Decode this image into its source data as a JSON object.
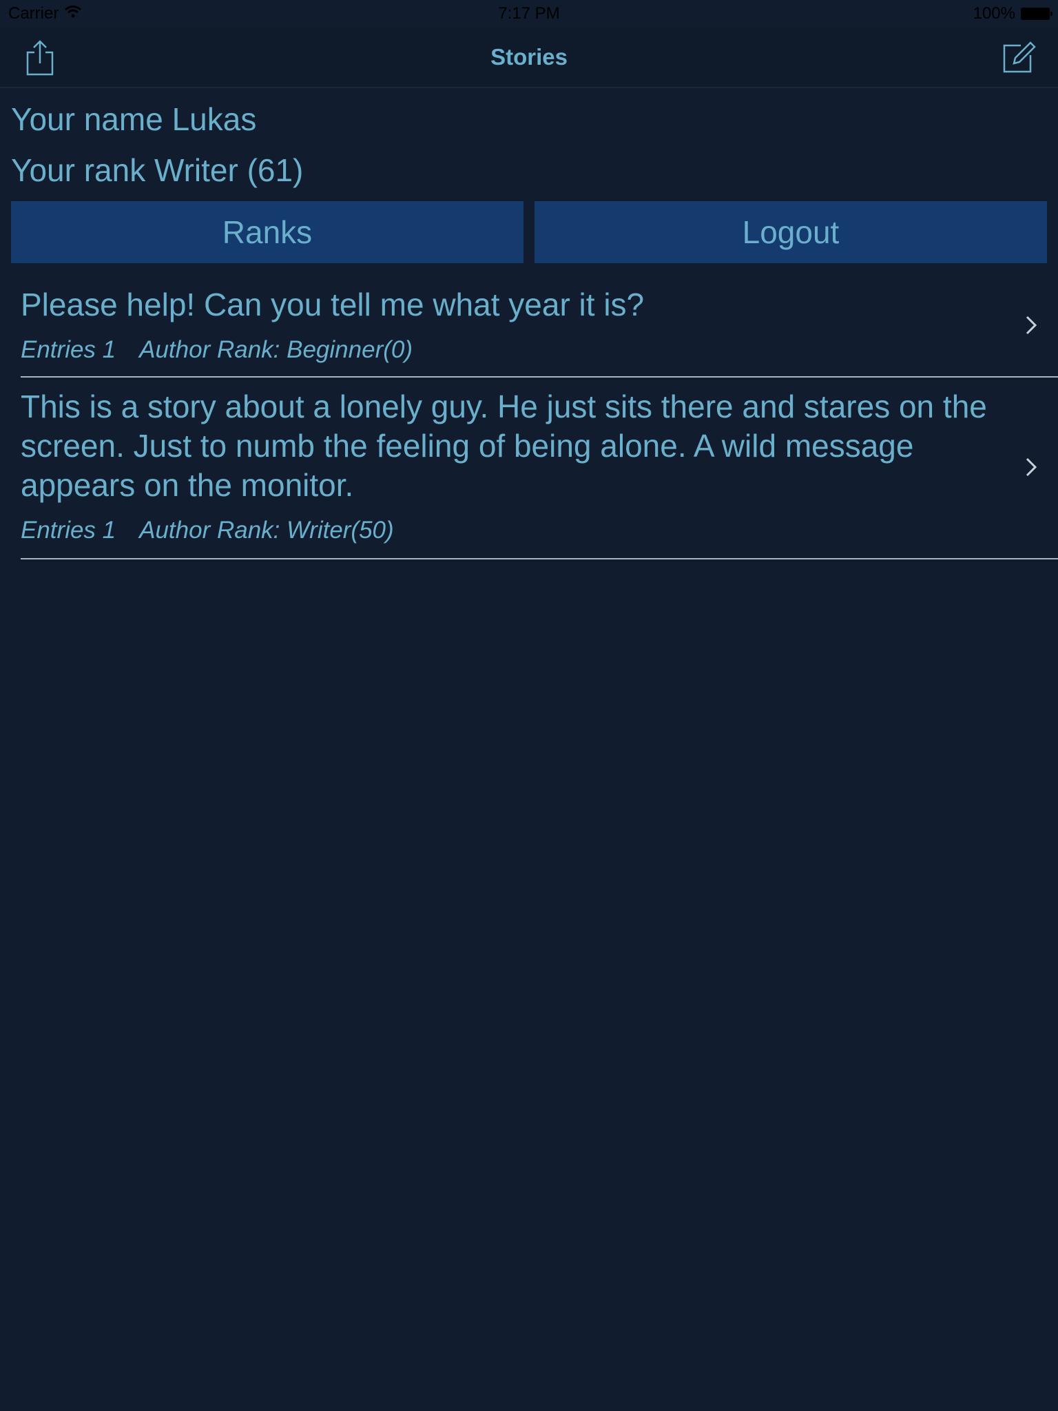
{
  "status_bar": {
    "carrier": "Carrier",
    "time": "7:17 PM",
    "battery": "100%"
  },
  "nav": {
    "title": "Stories",
    "left_icon": "share-icon",
    "right_icon": "compose-icon"
  },
  "profile": {
    "name_line": "Your name Lukas",
    "rank_line": "Your rank Writer (61)"
  },
  "actions": {
    "ranks_label": "Ranks",
    "logout_label": "Logout"
  },
  "stories": [
    {
      "title": "Please help! Can you tell me what year it is?",
      "entries": "Entries 1",
      "author_rank": "Author Rank: Beginner(0)"
    },
    {
      "title": "This is a story about a lonely guy. He just sits there and stares on the screen. Just to numb the feeling of being alone. A wild message appears on the monitor.",
      "entries": "Entries 1",
      "author_rank": "Author Rank: Writer(50)"
    }
  ],
  "colors": {
    "background": "#111c2e",
    "accent_text": "#6ab0cc",
    "button": "#143a6e"
  }
}
